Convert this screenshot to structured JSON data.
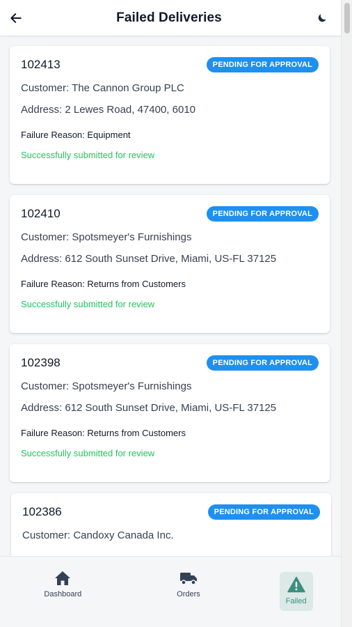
{
  "header": {
    "title": "Failed Deliveries",
    "back_icon": "arrow-left-icon",
    "theme_icon": "moon-icon"
  },
  "colors": {
    "badge": "#1e90f0",
    "success": "#21c55d",
    "active_tab_bg": "#dde9e6",
    "active_tab_text": "#3b8f7e"
  },
  "orders": [
    {
      "id": "102413",
      "status": "PENDING FOR APPROVAL",
      "customer": "Customer: The Cannon Group PLC",
      "address": "Address: 2 Lewes Road, 47400, 6010",
      "reason": "Failure Reason: Equipment",
      "submitted": "Successfully submitted for review"
    },
    {
      "id": "102410",
      "status": "PENDING FOR APPROVAL",
      "customer": "Customer: Spotsmeyer's Furnishings",
      "address": "Address: 612 South Sunset Drive, Miami, US-FL 37125",
      "reason": "Failure Reason: Returns from Customers",
      "submitted": "Successfully submitted for review"
    },
    {
      "id": "102398",
      "status": "PENDING FOR APPROVAL",
      "customer": "Customer: Spotsmeyer's Furnishings",
      "address": "Address: 612 South Sunset Drive, Miami, US-FL 37125",
      "reason": "Failure Reason: Returns from Customers",
      "submitted": "Successfully submitted for review"
    },
    {
      "id": "102386",
      "status": "PENDING FOR APPROVAL",
      "customer": "Customer: Candoxy Canada Inc."
    }
  ],
  "nav": {
    "dashboard": "Dashboard",
    "orders": "Orders",
    "failed": "Failed"
  }
}
